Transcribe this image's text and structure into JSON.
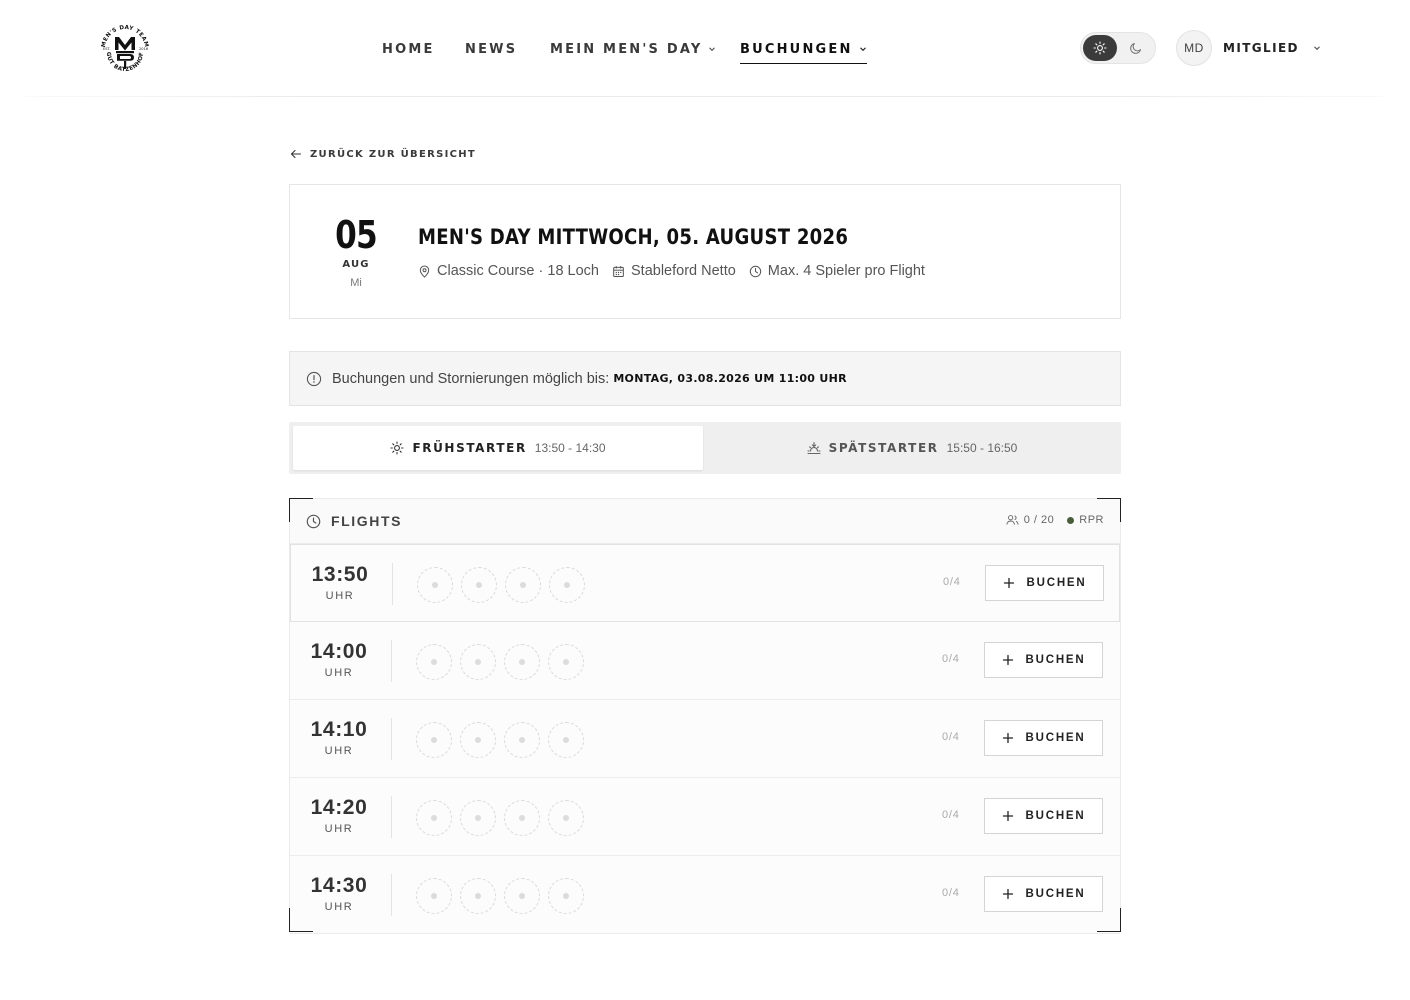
{
  "header": {
    "logo": {
      "icon": "club-crest-logo",
      "text_top": "MEN'S DAY TEAM",
      "text_bottom": "GUT BATZENHOF",
      "est": "EST.",
      "year": "2016"
    },
    "nav": [
      {
        "label": "HOME",
        "dropdown": false,
        "active": false
      },
      {
        "label": "NEWS",
        "dropdown": false,
        "active": false
      },
      {
        "label": "MEIN MEN'S DAY",
        "dropdown": true,
        "active": false
      },
      {
        "label": "BUCHUNGEN",
        "dropdown": true,
        "active": true
      }
    ],
    "theme": {
      "light_icon": "sun-icon",
      "dark_icon": "moon-icon",
      "selected": "light"
    },
    "user": {
      "initials": "MD",
      "label": "MITGLIED"
    }
  },
  "back_link": {
    "label": "ZURÜCK ZUR ÜBERSICHT",
    "icon": "arrow-left-icon"
  },
  "event": {
    "day": "05",
    "month": "AUG",
    "weekday": "Mi",
    "title": "MEN'S DAY MITTWOCH, 05. AUGUST 2026",
    "meta": [
      {
        "icon": "map-pin-icon",
        "text": "Classic Course · 18 Loch"
      },
      {
        "icon": "calendar-icon",
        "text": "Stableford Netto"
      },
      {
        "icon": "clock-icon",
        "text": "Max. 4 Spieler pro Flight"
      }
    ]
  },
  "notice": {
    "icon": "info-circle-icon",
    "text": "Buchungen und Stornierungen möglich bis:",
    "deadline": "MONTAG, 03.08.2026 UM 11:00 UHR"
  },
  "tabs": [
    {
      "label": "FRÜHSTARTER",
      "time": "13:50 - 14:30",
      "icon": "sun-icon",
      "active": true
    },
    {
      "label": "SPÄTSTARTER",
      "time": "15:50 - 16:50",
      "icon": "sunset-icon",
      "active": false
    }
  ],
  "flights": {
    "title": "FLIGHTS",
    "count": "0 / 20",
    "legend": "RPR",
    "colors": {
      "legend_dot": "#4a5d3a"
    },
    "rows": [
      {
        "time": "13:50",
        "unit": "UHR",
        "count": "0/4",
        "button": "BUCHEN"
      },
      {
        "time": "14:00",
        "unit": "UHR",
        "count": "0/4",
        "button": "BUCHEN"
      },
      {
        "time": "14:10",
        "unit": "UHR",
        "count": "0/4",
        "button": "BUCHEN"
      },
      {
        "time": "14:20",
        "unit": "UHR",
        "count": "0/4",
        "button": "BUCHEN"
      },
      {
        "time": "14:30",
        "unit": "UHR",
        "count": "0/4",
        "button": "BUCHEN"
      }
    ]
  }
}
